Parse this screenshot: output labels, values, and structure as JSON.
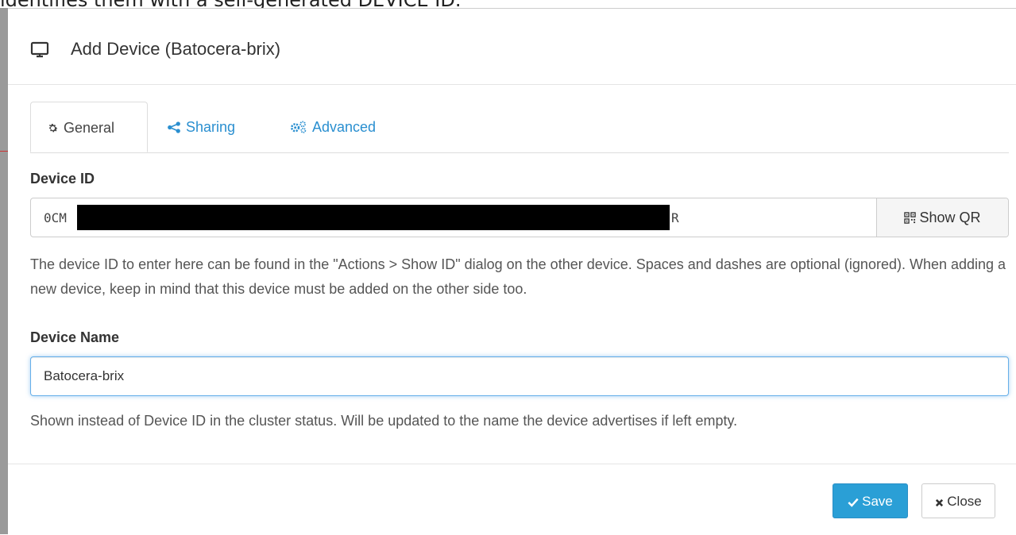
{
  "background": {
    "partial_text": "identifies them with a self-generated DEVICE ID."
  },
  "modal": {
    "title": "Add Device (Batocera-brix)",
    "title_icon": "monitor-icon",
    "tabs": [
      {
        "label": "General",
        "icon": "gear-icon",
        "active": true
      },
      {
        "label": "Sharing",
        "icon": "share-icon",
        "active": false
      },
      {
        "label": "Advanced",
        "icon": "cogs-icon",
        "active": false
      }
    ],
    "device_id": {
      "label": "Device ID",
      "value_start": "0CM",
      "value_end": "R",
      "show_qr_label": "Show QR",
      "help": "The device ID to enter here can be found in the \"Actions > Show ID\" dialog on the other device. Spaces and dashes are optional (ignored). When adding a new device, keep in mind that this device must be added on the other side too."
    },
    "device_name": {
      "label": "Device Name",
      "value": "Batocera-brix",
      "help": "Shown instead of Device ID in the cluster status. Will be updated to the name the device advertises if left empty."
    },
    "footer": {
      "save_label": "Save",
      "close_label": "Close"
    }
  },
  "colors": {
    "accent": "#2a9fd6",
    "link": "#2a8fd0",
    "focus_border": "#66afe9"
  }
}
